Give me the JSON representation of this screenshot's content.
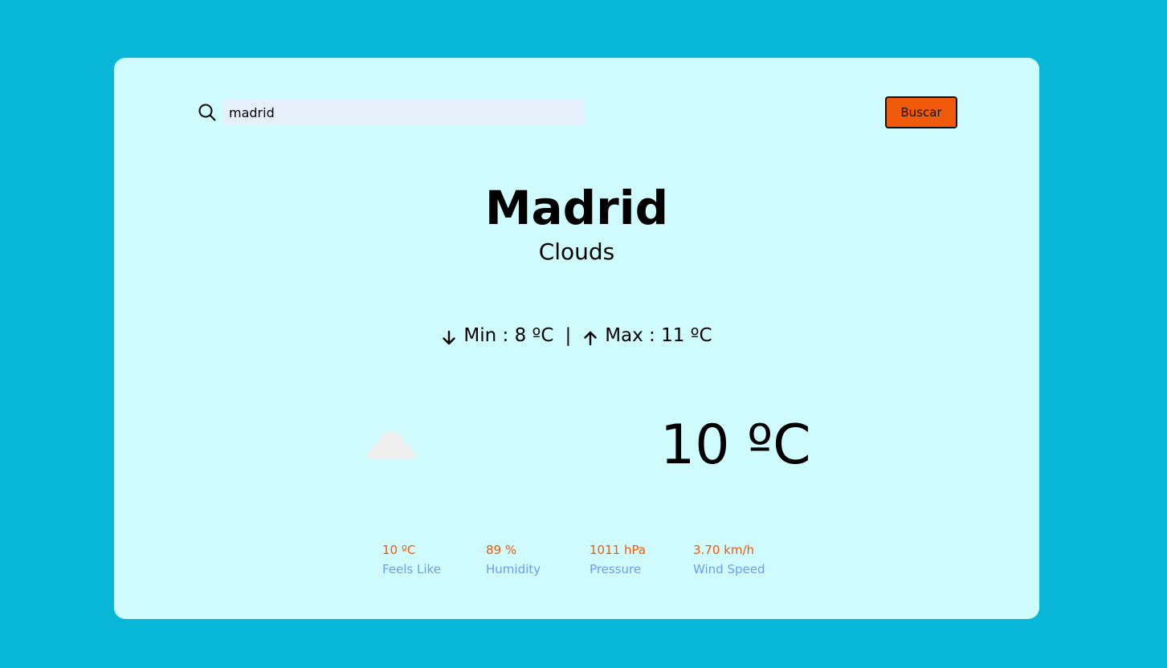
{
  "search": {
    "value": "madrid",
    "button_label": "Buscar"
  },
  "weather": {
    "city": "Madrid",
    "condition": "Clouds",
    "min_label": "Min : 8 ºC",
    "separator": "|",
    "max_label": "Max : 11 ºC",
    "temperature": "10 ºC",
    "icon": "cloud-icon"
  },
  "stats": [
    {
      "value": "10 ºC",
      "label": "Feels Like"
    },
    {
      "value": "89 %",
      "label": "Humidity"
    },
    {
      "value": "1011 hPa",
      "label": "Pressure"
    },
    {
      "value": "3.70 km/h",
      "label": "Wind Speed"
    }
  ],
  "colors": {
    "background": "#08b6d7",
    "card": "#d0fbfd",
    "accent": "#ef5a0b",
    "label": "#6f9cf0"
  }
}
